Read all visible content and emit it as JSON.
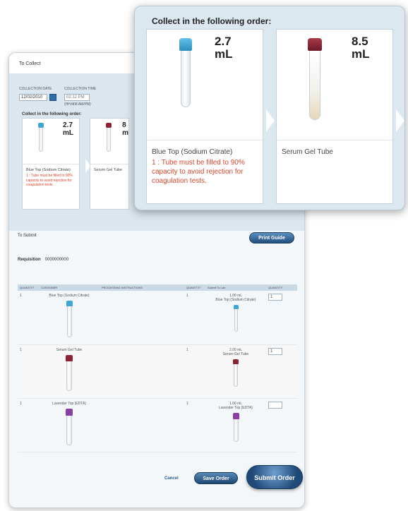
{
  "popup": {
    "title": "Collect in the following order:",
    "cards": [
      {
        "volume": "2.7 mL",
        "volume_num": "2.7",
        "volume_unit": "mL",
        "name": "Blue Top (Sodium Citrate)",
        "warning": "1 : Tube must be filled to 90% capacity to avoid rejection for coagulation tests.",
        "cap_color": "#3fa7d6"
      },
      {
        "volume": "8.5 mL",
        "volume_num": "8.5",
        "volume_unit": "mL",
        "name": "Serum Gel Tube",
        "warning": "",
        "cap_color": "#8b2332"
      }
    ]
  },
  "collect": {
    "section_title": "To Collect",
    "date_label": "COLLECTION DATE",
    "date_value": "12/02/2010",
    "time_label": "COLLECTION TIME",
    "time_value": "02:12 PM",
    "time_sub": "(HH:MM AM/PM)",
    "order_label": "Collect in the following order:",
    "mini_cards": [
      {
        "volume_num": "2.7",
        "volume_unit": "mL",
        "name": "Blue Top (Sodium Citrate)",
        "warning": "1 : Tube must be filled to 90% capacity to avoid rejection for coagulation tests."
      },
      {
        "volume_num": "8",
        "volume_unit": "m",
        "name": "Serum Gel Tube",
        "warning": ""
      }
    ]
  },
  "submit": {
    "section_title": "To Submit",
    "print_label": "Print Guide",
    "requisition_label": "Requisition",
    "requisition_value": "0000000000",
    "columns": [
      "QUANTITY",
      "CONTAINER",
      "PROCESSING INSTRUCTIONS",
      "QUANTITY",
      "Submit To Lab",
      "QUANTITY"
    ],
    "rows": [
      {
        "qty": "1",
        "container": "Blue Top (Sodium Citrate)",
        "instructions": "",
        "qty2": "1",
        "lab_volume": "1.00 mL",
        "lab_container": "Blue Top (Sodium Citrate)",
        "qty3": "1",
        "cap_color": "#3fa7d6"
      },
      {
        "qty": "1",
        "container": "Serum Gel Tube",
        "instructions": "",
        "qty2": "1",
        "lab_volume": "2.00 mL",
        "lab_container": "Serum Gel Tube",
        "qty3": "1",
        "cap_color": "#8b2332"
      },
      {
        "qty": "1",
        "container": "Lavender Top (EDTA)",
        "instructions": "",
        "qty2": "1",
        "lab_volume": "1.00 mL",
        "lab_container": "Lavender Top (EDTA)",
        "qty3": "",
        "cap_color": "#8a3fa5"
      }
    ]
  },
  "actions": {
    "cancel_label": "Cancel",
    "save_label": "Save Order",
    "submit_label": "Submit Order"
  }
}
